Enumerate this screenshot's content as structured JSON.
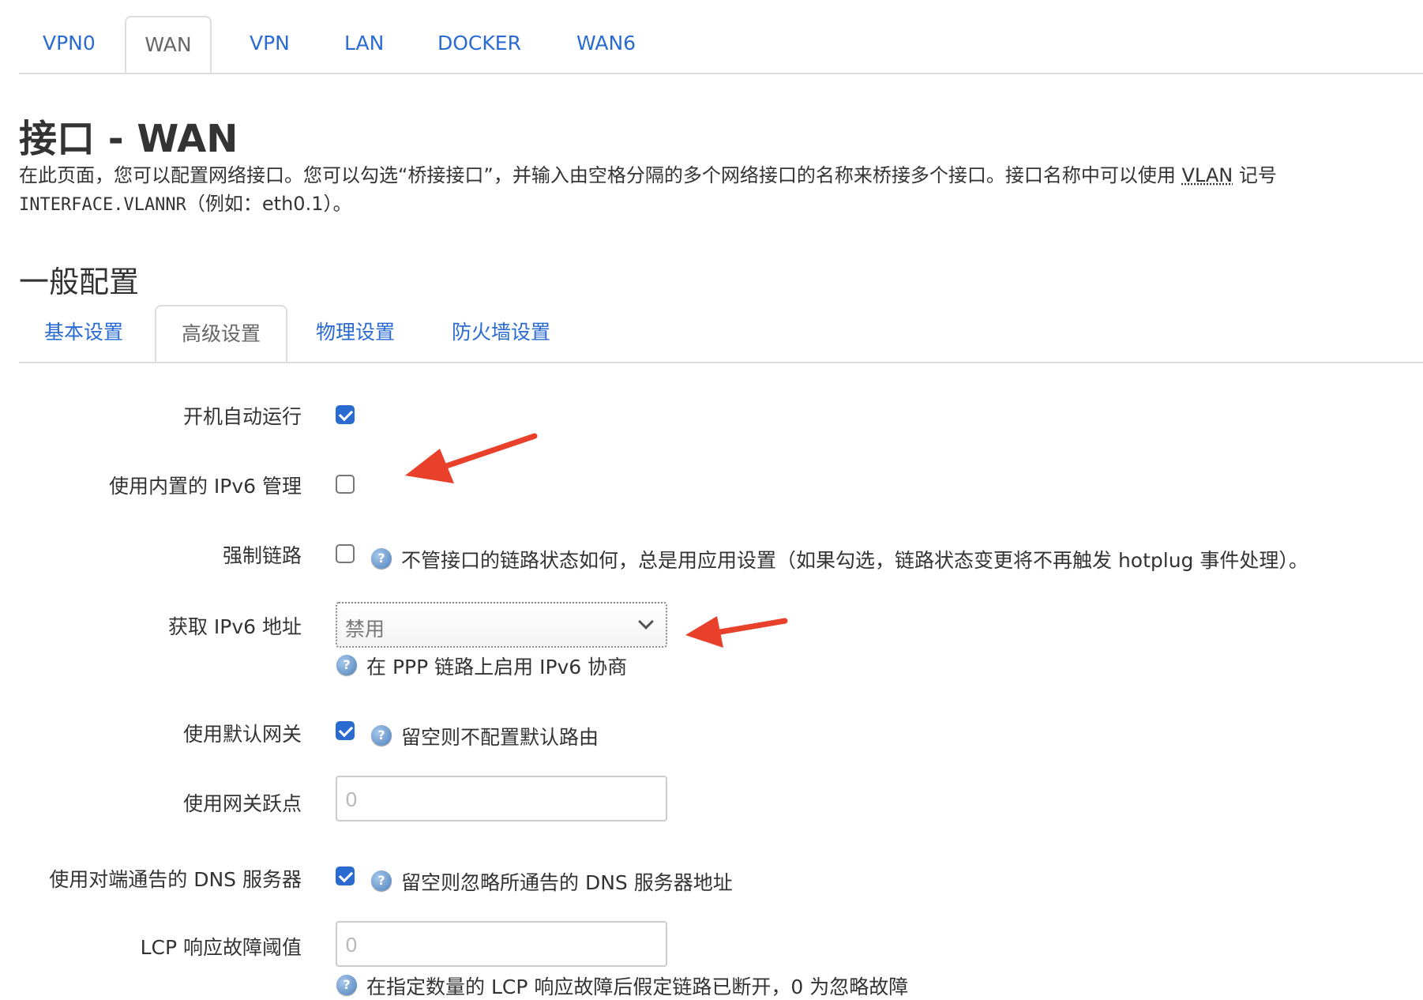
{
  "top_tabs": [
    "VPN0",
    "WAN",
    "VPN",
    "LAN",
    "DOCKER",
    "WAN6"
  ],
  "page_title": "接口 - WAN",
  "description": {
    "line1_prefix": "在此页面，您可以配置网络接口。您可以勾选“桥接接口”，并输入由空格分隔的多个网络接口的名称来桥接多个接口。接口名称中可以使用 ",
    "vlan": "VLAN",
    "line1_suffix": " 记号",
    "code": "INTERFACE.VLANNR",
    "line2_suffix": "（例如：eth0.1）。"
  },
  "section_title": "一般配置",
  "sub_tabs": [
    "基本设置",
    "高级设置",
    "物理设置",
    "防火墙设置"
  ],
  "fields": {
    "autostart": {
      "label": "开机自动运行",
      "checked": true
    },
    "builtin_ipv6": {
      "label": "使用内置的 IPv6 管理",
      "checked": false
    },
    "force_link": {
      "label": "强制链路",
      "checked": false,
      "help": "不管接口的链路状态如何，总是用应用设置（如果勾选，链路状态变更将不再触发 hotplug 事件处理）。"
    },
    "ipv6_addr": {
      "label": "获取 IPv6 地址",
      "value": "禁用",
      "help": "在 PPP 链路上启用 IPv6 协商"
    },
    "default_gw": {
      "label": "使用默认网关",
      "checked": true,
      "help": "留空则不配置默认路由"
    },
    "gw_metric": {
      "label": "使用网关跃点",
      "placeholder": "0"
    },
    "peer_dns": {
      "label": "使用对端通告的 DNS 服务器",
      "checked": true,
      "help": "留空则忽略所通告的 DNS 服务器地址"
    },
    "lcp_threshold": {
      "label": "LCP 响应故障阈值",
      "placeholder": "0",
      "help": "在指定数量的 LCP 响应故障后假定链路已断开，0 为忽略故障"
    }
  },
  "help_icon_glyph": "?",
  "colors": {
    "link": "#2a6bd1",
    "annotation_arrow": "#e8402a",
    "checkbox": "#2a6bd1"
  }
}
